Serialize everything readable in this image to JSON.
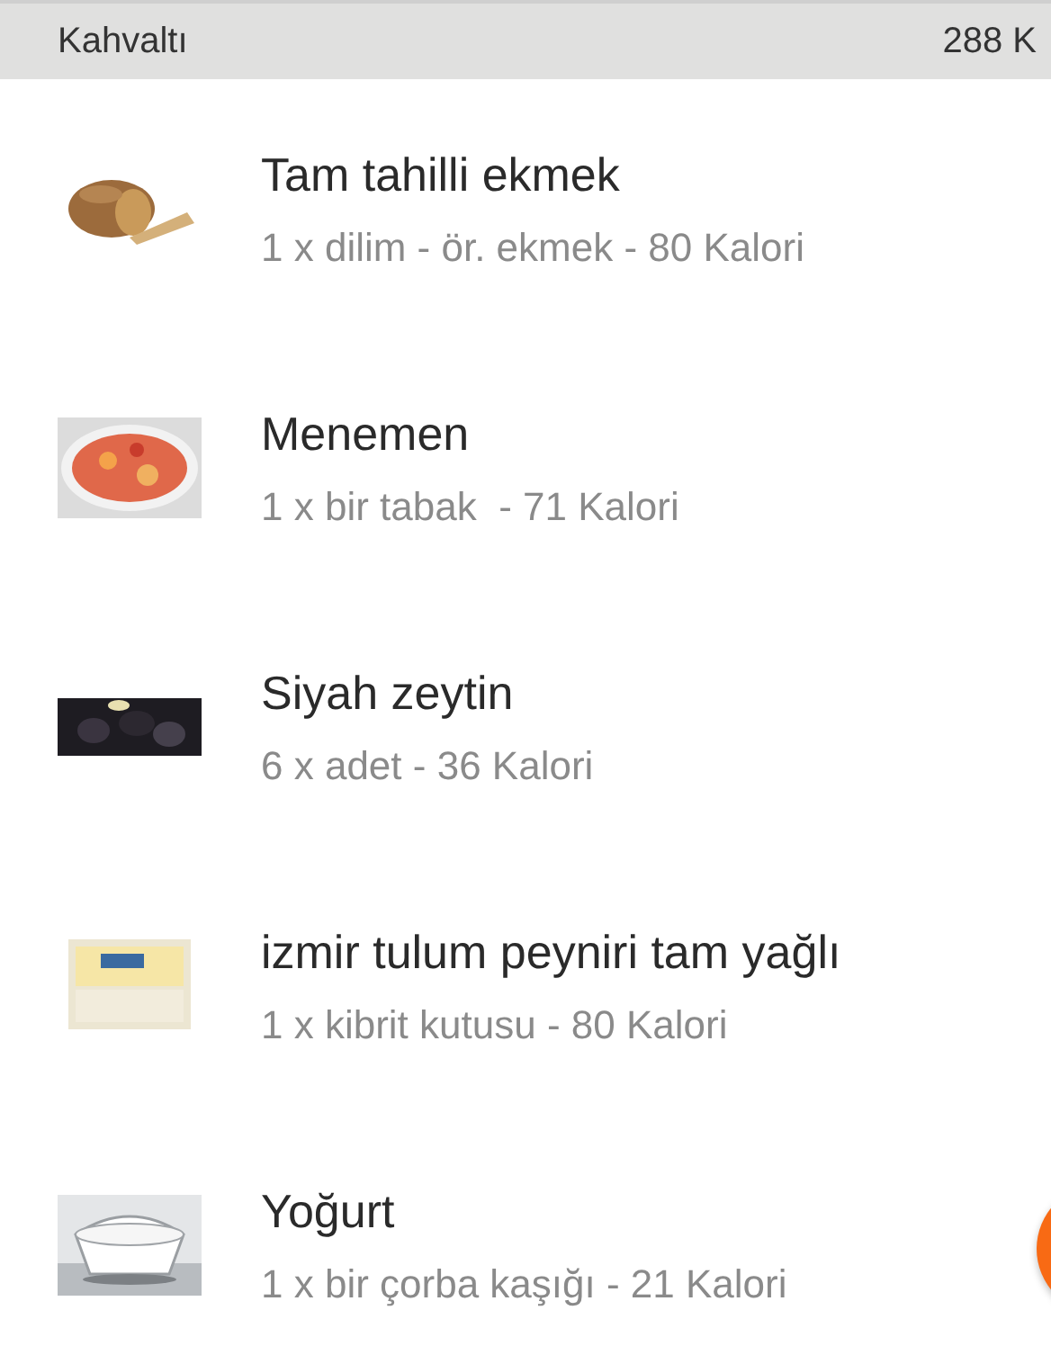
{
  "header": {
    "title": "Kahvaltı",
    "total": "288 K"
  },
  "items": [
    {
      "name": "Tam tahilli ekmek",
      "detail": "1 x dilim - ör. ekmek - 80 Kalori"
    },
    {
      "name": "Menemen",
      "detail": "1 x bir tabak  - 71 Kalori"
    },
    {
      "name": "Siyah zeytin",
      "detail": "6 x adet - 36 Kalori"
    },
    {
      "name": "izmir tulum peyniri tam yağlı",
      "detail": "1 x kibrit kutusu - 80 Kalori"
    },
    {
      "name": "Yoğurt",
      "detail": "1 x bir çorba kaşığı - 21 Kalori"
    }
  ]
}
